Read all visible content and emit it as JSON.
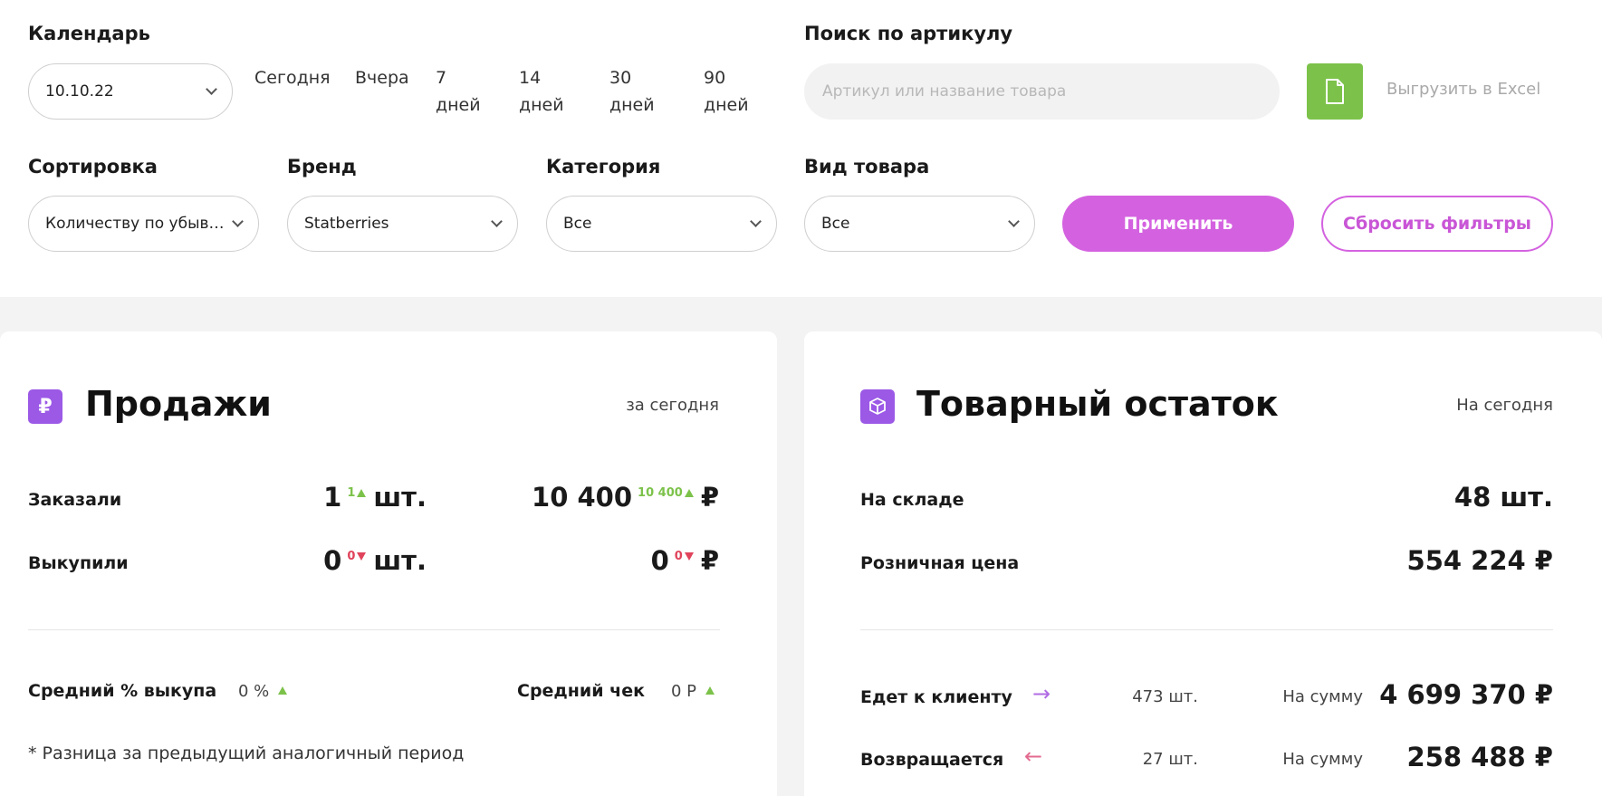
{
  "filters": {
    "calendar": {
      "label": "Календарь",
      "value": "10.10.22"
    },
    "periods": [
      "Сегодня",
      "Вчера",
      "7\nдней",
      "14\nдней",
      "30\nдней",
      "90\nдней"
    ],
    "search": {
      "label": "Поиск по артикулу",
      "placeholder": "Артикул или название товара"
    },
    "export_label": "Выгрузить в Excel",
    "sort": {
      "label": "Сортировка",
      "value": "Количеству по убыванию"
    },
    "brand": {
      "label": "Бренд",
      "value": "Statberries"
    },
    "category": {
      "label": "Категория",
      "value": "Все"
    },
    "product_type": {
      "label": "Вид товара",
      "value": "Все"
    },
    "apply_label": "Применить",
    "reset_label": "Сбросить фильтры"
  },
  "sales": {
    "icon": "₽",
    "title": "Продажи",
    "period": "за сегодня",
    "ordered": {
      "label": "Заказали",
      "qty": "1",
      "qty_delta": "1",
      "unit": "шт.",
      "sum": "10 400",
      "sum_delta": "10 400",
      "currency": "₽"
    },
    "bought": {
      "label": "Выкупили",
      "qty": "0",
      "qty_delta": "0",
      "unit": "шт.",
      "sum": "0",
      "sum_delta": "0",
      "currency": "₽"
    },
    "avg_buyout": {
      "label": "Средний % выкупа",
      "value": "0 %"
    },
    "avg_check": {
      "label": "Средний чек",
      "value": "0 Р"
    },
    "note": "* Разница за предыдущий аналогичный период"
  },
  "stock": {
    "title": "Товарный остаток",
    "period": "На сегодня",
    "warehouse": {
      "label": "На складе",
      "value": "48 шт."
    },
    "retail": {
      "label": "Розничная цена",
      "value": "554 224 ₽"
    },
    "to_client": {
      "label": "Едет к клиенту",
      "arrow": "→",
      "qty": "473 шт.",
      "sum_label": "На сумму",
      "sum": "4 699 370 ₽"
    },
    "returning": {
      "label": "Возвращается",
      "arrow": "←",
      "qty": "27 шт.",
      "sum_label": "На сумму",
      "sum": "258 488 ₽"
    }
  },
  "colors": {
    "accent": "#d462e0",
    "icon_bg": "#9b59e6",
    "excel_green": "#7cc24a",
    "up": "#7cc24a",
    "down": "#e0435b"
  }
}
